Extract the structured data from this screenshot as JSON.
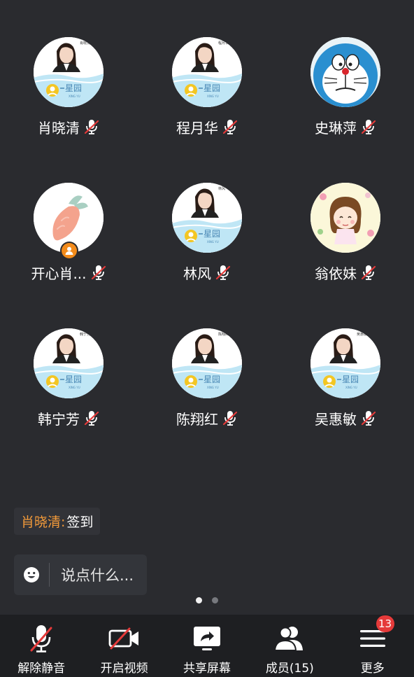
{
  "participants": [
    {
      "name": "肖晓清",
      "avatar": "photo-xingyu",
      "caption": "肖晓清",
      "muted": true
    },
    {
      "name": "程月华",
      "avatar": "photo-xingyu",
      "caption": "程月华",
      "muted": true
    },
    {
      "name": "史琳萍",
      "avatar": "doraemon",
      "muted": true
    },
    {
      "name": "开心肖...",
      "avatar": "carrot",
      "host": true,
      "muted": true
    },
    {
      "name": "林风",
      "avatar": "photo-xingyu",
      "caption": "林风",
      "muted": true
    },
    {
      "name": "翁依妹",
      "avatar": "cartoon-girl",
      "muted": true
    },
    {
      "name": "韩宁芳",
      "avatar": "photo-xingyu",
      "caption": "韩宁芳",
      "muted": true
    },
    {
      "name": "陈翔红",
      "avatar": "photo-xingyu",
      "caption": "陈翔红",
      "muted": true
    },
    {
      "name": "吴惠敏",
      "avatar": "photo-xingyu",
      "caption": "吴惠敏",
      "muted": true
    }
  ],
  "xingyu_brand": {
    "cn": "星园",
    "en": "XING YU"
  },
  "chat": {
    "last_message": {
      "sender": "肖晓清:",
      "text": " 签到"
    },
    "input_placeholder": "说点什么..."
  },
  "pager": {
    "pages": 2,
    "current": 1
  },
  "toolbar": {
    "unmute": {
      "label": "解除静音",
      "icon": "mic-muted-icon"
    },
    "video": {
      "label": "开启视频",
      "icon": "video-off-icon"
    },
    "share": {
      "label": "共享屏幕",
      "icon": "share-screen-icon"
    },
    "members": {
      "label": "成员(15)",
      "icon": "members-icon"
    },
    "more": {
      "label": "更多",
      "icon": "menu-icon",
      "badge": "13"
    }
  },
  "colors": {
    "background": "#2a2b2f",
    "toolbar": "#1e1f22",
    "accent_orange": "#f28b1b",
    "mute_red": "#e53a3a",
    "badge_red": "#e53a3a",
    "xingyu_blue": "#bfe6f5"
  }
}
